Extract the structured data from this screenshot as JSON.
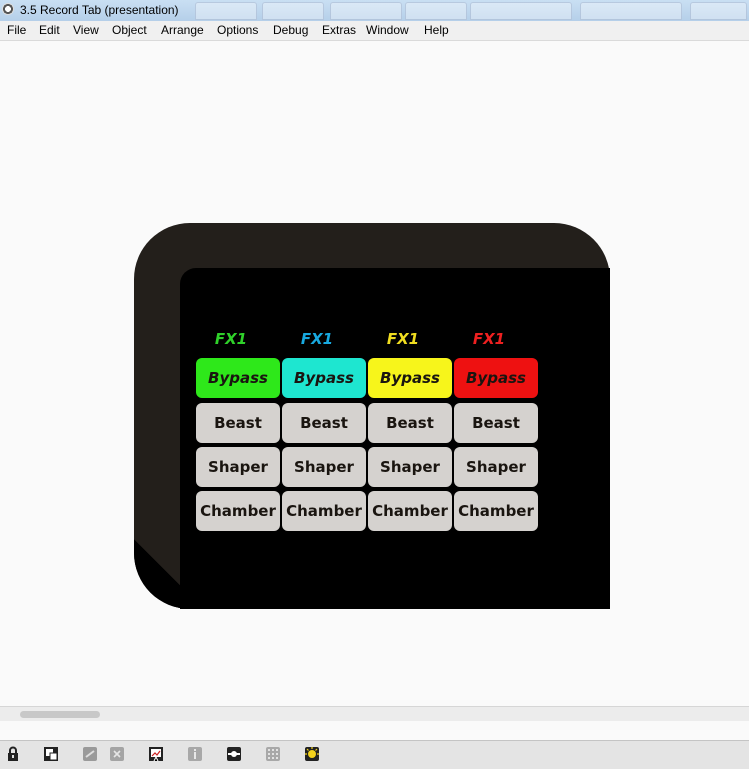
{
  "window": {
    "title": "3.5 Record Tab (presentation)"
  },
  "menu": [
    "File",
    "Edit",
    "View",
    "Object",
    "Arrange",
    "Options",
    "Debug",
    "Extras",
    "Window",
    "Help"
  ],
  "panel": {
    "columns": [
      {
        "fx_label": "FX1",
        "color": "#2ee81a"
      },
      {
        "fx_label": "FX1",
        "color": "#1ee6d0"
      },
      {
        "fx_label": "FX1",
        "color": "#f7f51b"
      },
      {
        "fx_label": "FX1",
        "color": "#ee1111"
      }
    ],
    "label_colors": [
      "#2fd12a",
      "#18a9e0",
      "#f0dd20",
      "#ee2020"
    ],
    "rows": [
      [
        "Bypass",
        "Bypass",
        "Bypass",
        "Bypass"
      ],
      [
        "Beast",
        "Beast",
        "Beast",
        "Beast"
      ],
      [
        "Shaper",
        "Shaper",
        "Shaper",
        "Shaper"
      ],
      [
        "Chamber",
        "Chamber",
        "Chamber",
        "Chamber"
      ]
    ]
  },
  "toolbar": {
    "icons": [
      "lock-icon",
      "presentation-mode-icon",
      "link-icon",
      "close-icon",
      "chart-icon",
      "info-icon",
      "patch-cord-icon",
      "grid-icon",
      "bulb-icon"
    ]
  }
}
